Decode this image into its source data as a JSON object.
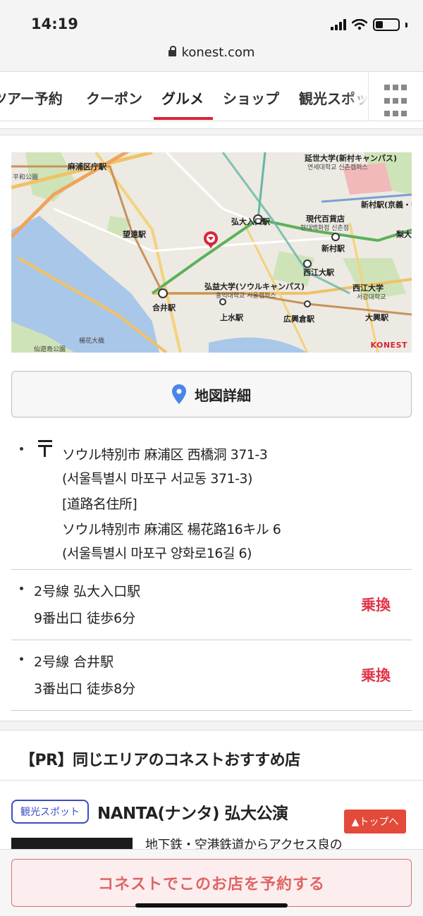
{
  "status_bar": {
    "time": "14:19"
  },
  "browser": {
    "url": "konest.com"
  },
  "tabs": [
    {
      "label": "ツアー予約"
    },
    {
      "label": "クーポン"
    },
    {
      "label": "グルメ",
      "active": true
    },
    {
      "label": "ショップ"
    },
    {
      "label": "観光スポット"
    }
  ],
  "map": {
    "labels": {
      "mapo_office": "麻浦区庁駅",
      "hapjeong_area": "平和公園",
      "mangwon": "望遠駅",
      "hongik_univ_station": "弘大入口駅",
      "hyundai_dept": "現代百貨店",
      "hyundai_dept_kr": "현대백화점 신촌점",
      "sinchon": "新村駅",
      "sinchon_2": "新村駅(京義・中央線)",
      "yonsei": "延世大学(新村キャンパス)",
      "yonsei_kr": "연세대학교 신촌캠퍼스",
      "hongik_univ": "弘益大学(ソウルキャンパス)",
      "hongik_univ_kr": "홍익대학교 서울캠퍼스",
      "seogang": "西江大駅",
      "sogang_univ": "西江大学",
      "sogang_univ_kr": "서강대학교",
      "hapjeong": "合井駅",
      "sangsu": "上水駅",
      "gwangheungchang": "広興倉駅",
      "daeheung": "大興駅",
      "ewha": "梨大",
      "yanghwa_park": "楊花大橋",
      "seonyudo": "仙遊島公園",
      "logo": "KONEST"
    }
  },
  "map_button": {
    "label": "地図詳細",
    "icon": "map-pin-icon"
  },
  "address": {
    "lines": [
      "ソウル特別市 麻浦区 西橋洞 371-3",
      "(서울특별시 마포구 서교동 371-3)",
      "[道路名住所]",
      "ソウル特別市 麻浦区 楊花路16キル 6",
      "(서울특별시 마포구 양화로16길 6)"
    ]
  },
  "stations": [
    {
      "line": "2号線 弘大入口駅",
      "access": "9番出口 徒歩6分",
      "transfer": "乗換"
    },
    {
      "line": "2号線 合井駅",
      "access": "3番出口 徒歩8分",
      "transfer": "乗換"
    }
  ],
  "pr_section": {
    "title": "【PR】同じエリアのコネストおすすめ店",
    "item": {
      "badge": "観光スポット",
      "name": "NANTA(ナンタ) 弘大公演",
      "desc": "地下鉄・空港鉄道からアクセス良の"
    },
    "to_top": "▲トップへ"
  },
  "reserve_button": "コネストでこのお店を予約する",
  "colors": {
    "accent": "#d8243a",
    "badge": "#3b4cc8",
    "transfer": "#e0364a",
    "to_top": "#e34a3a"
  }
}
